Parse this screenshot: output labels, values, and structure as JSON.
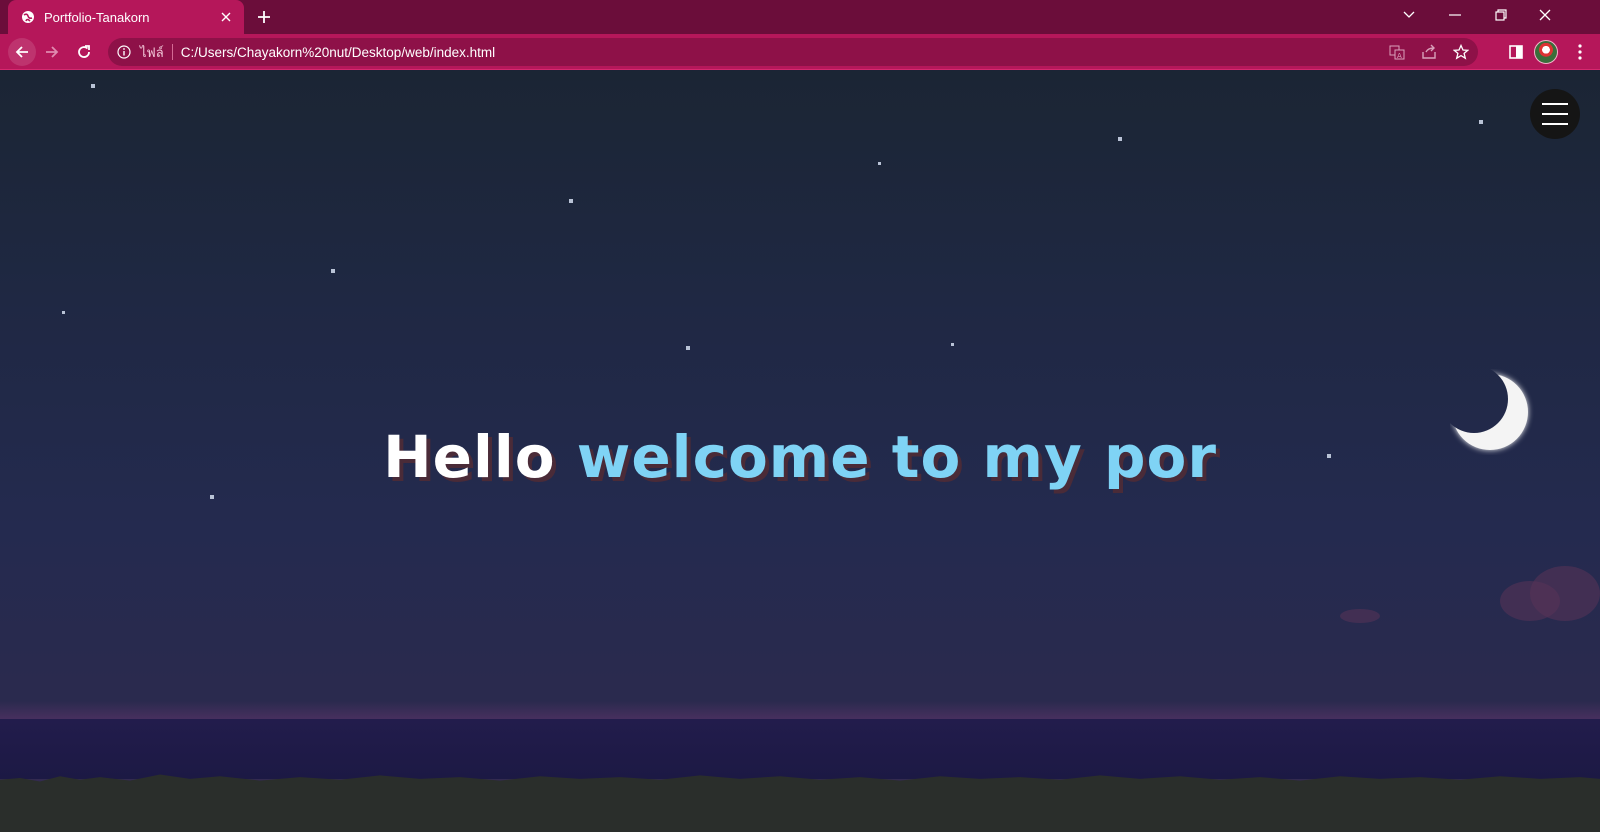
{
  "browser": {
    "tab_title": "Portfolio-Tanakorn",
    "file_label": "ไฟล์",
    "url": "C:/Users/Chayakorn%20nut/Desktop/web/index.html",
    "accent_color": "#b5175a",
    "tabbar_color": "#6b0d3a"
  },
  "page": {
    "headline_hello": "Hello",
    "headline_rest": "welcome to my por",
    "hello_color": "#ffffff",
    "rest_color": "#7fd3f5",
    "menu_icon": "hamburger-icon",
    "moon_icon": "crescent-moon"
  }
}
